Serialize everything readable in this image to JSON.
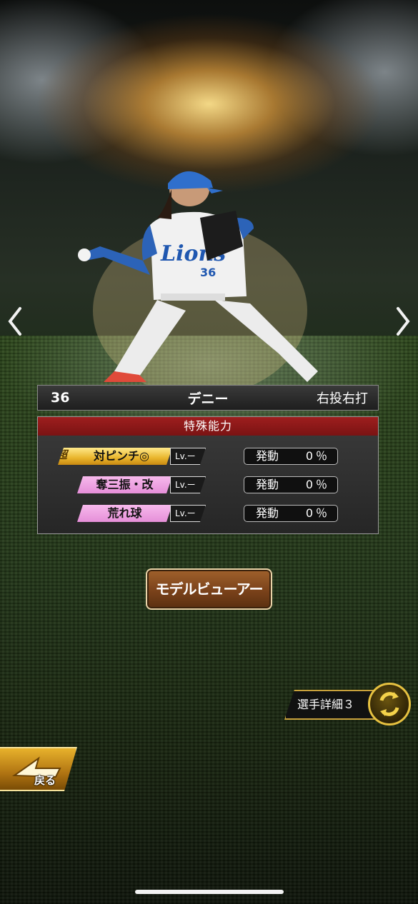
{
  "player": {
    "number": "36",
    "name": "デニー",
    "throw_bat": "右投右打",
    "jersey_text": "Lions",
    "jersey_number": "36"
  },
  "abilities_panel": {
    "title": "特殊能力",
    "rows": [
      {
        "super_mark": "超",
        "name": "対ピンチ◎",
        "level": "Lv.ー",
        "activation_label": "発動",
        "activation_value": "0％",
        "tag_color": "gold"
      },
      {
        "name": "奪三振・改",
        "level": "Lv.ー",
        "activation_label": "発動",
        "activation_value": "0％",
        "tag_color": "pink"
      },
      {
        "name": "荒れ球",
        "level": "Lv.ー",
        "activation_label": "発動",
        "activation_value": "0％",
        "tag_color": "pink"
      }
    ]
  },
  "buttons": {
    "model_viewer": "モデルビューアー",
    "player_detail": "選手詳細３",
    "back": "戻る"
  },
  "icons": {
    "prev": "chevron-left-icon",
    "next": "chevron-right-icon",
    "swap": "swap-arrows-icon",
    "back": "back-arrow-icon"
  },
  "colors": {
    "ability_gold": "#e9b52c",
    "ability_pink": "#e58fd8",
    "panel_header": "#9e1e1e",
    "model_button": "#7a421a"
  }
}
